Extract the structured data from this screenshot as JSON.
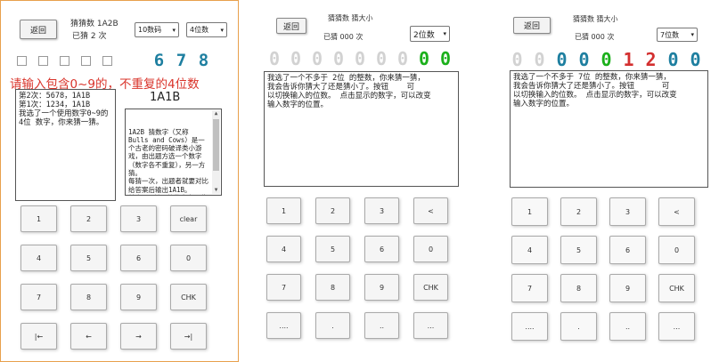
{
  "panel1": {
    "back_label": "返回",
    "game_title": "猜猜数 1A2B",
    "guess_count": "已猜 2 次",
    "mode_select": "10数码",
    "digits_select": "4位数",
    "revealed_digits": [
      "6",
      "7",
      "8"
    ],
    "prompt": "请输入包含0~9的，不重复的4位数",
    "last_result": "1A1B",
    "history_text": "第2次：5678，1A1B\n第1次：1234，1A1B\n我选了一个使用数字0~9的4位 数字，你来猜一猜。",
    "rules_text": "1A2B 猜数字（又称 Bulls and Cows）是一个古老的密码破译类小游戏，由出题方选一个数字（数字各不重复），另一方猜。\n每猜一次，出题者就要对比给答案后输出1A1B。\n其中 A 前面的数字表示位置正确的数的个数，\n而 B 前面的数字表示数字正确而位置不对的数的个数。",
    "keys": [
      [
        "1",
        "2",
        "3",
        "clear"
      ],
      [
        "4",
        "5",
        "6",
        "0"
      ],
      [
        "7",
        "8",
        "9",
        "CHK"
      ],
      [
        "|←",
        "←",
        "→",
        "→|"
      ]
    ]
  },
  "panel2": {
    "back_label": "返回",
    "game_title": "猜猜数 猜大小",
    "guess_count": "已猜 000 次",
    "digits_select": "2位数",
    "display_digits": [
      {
        "d": "0",
        "color": "#d2d2d2"
      },
      {
        "d": "0",
        "color": "#d2d2d2"
      },
      {
        "d": "0",
        "color": "#d2d2d2"
      },
      {
        "d": "0",
        "color": "#d2d2d2"
      },
      {
        "d": "0",
        "color": "#d2d2d2"
      },
      {
        "d": "0",
        "color": "#d2d2d2"
      },
      {
        "d": "0",
        "color": "#d2d2d2"
      },
      {
        "d": "0",
        "color": "#1bb01b"
      },
      {
        "d": "0",
        "color": "#1bb01b"
      }
    ],
    "message": "我选了一个不多于 2位 的整数，你来猜一猜，\n我会告诉你猜大了还是猜小了。按钮    可\n以切换输入的位数。 点击显示的数字，可以改变\n输入数字的位置。",
    "keys": [
      [
        "1",
        "2",
        "3",
        "<"
      ],
      [
        "4",
        "5",
        "6",
        "0"
      ],
      [
        "7",
        "8",
        "9",
        "CHK"
      ],
      [
        "....",
        ".",
        "..",
        "..."
      ]
    ]
  },
  "panel3": {
    "back_label": "返回",
    "game_title": "猜猜数 猜大小",
    "guess_count": "已猜 000 次",
    "digits_select": "7位数",
    "display_digits": [
      {
        "d": "0",
        "color": "#d2d2d2"
      },
      {
        "d": "0",
        "color": "#d2d2d2"
      },
      {
        "d": "0",
        "color": "#1e7fa0"
      },
      {
        "d": "0",
        "color": "#1e7fa0"
      },
      {
        "d": "0",
        "color": "#1bb01b"
      },
      {
        "d": "1",
        "color": "#d32f2f"
      },
      {
        "d": "2",
        "color": "#d32f2f"
      },
      {
        "d": "0",
        "color": "#1e7fa0"
      },
      {
        "d": "0",
        "color": "#1e7fa0"
      }
    ],
    "message": "我选了一个不多于 7位 的整数，你来猜一猜，\n我会告诉你猜大了还是猜小了。按钮      可\n以切换输入的位数。 点击显示的数字，可以改变\n输入数字的位置。",
    "keys": [
      [
        "1",
        "2",
        "3",
        "<"
      ],
      [
        "4",
        "5",
        "6",
        "0"
      ],
      [
        "7",
        "8",
        "9",
        "CHK"
      ],
      [
        "....",
        ".",
        "..",
        "..."
      ]
    ]
  },
  "colors": {
    "accent_teal": "#1e7fa0",
    "prompt_red": "#d9342b",
    "panel_border": "#e8a04c"
  }
}
